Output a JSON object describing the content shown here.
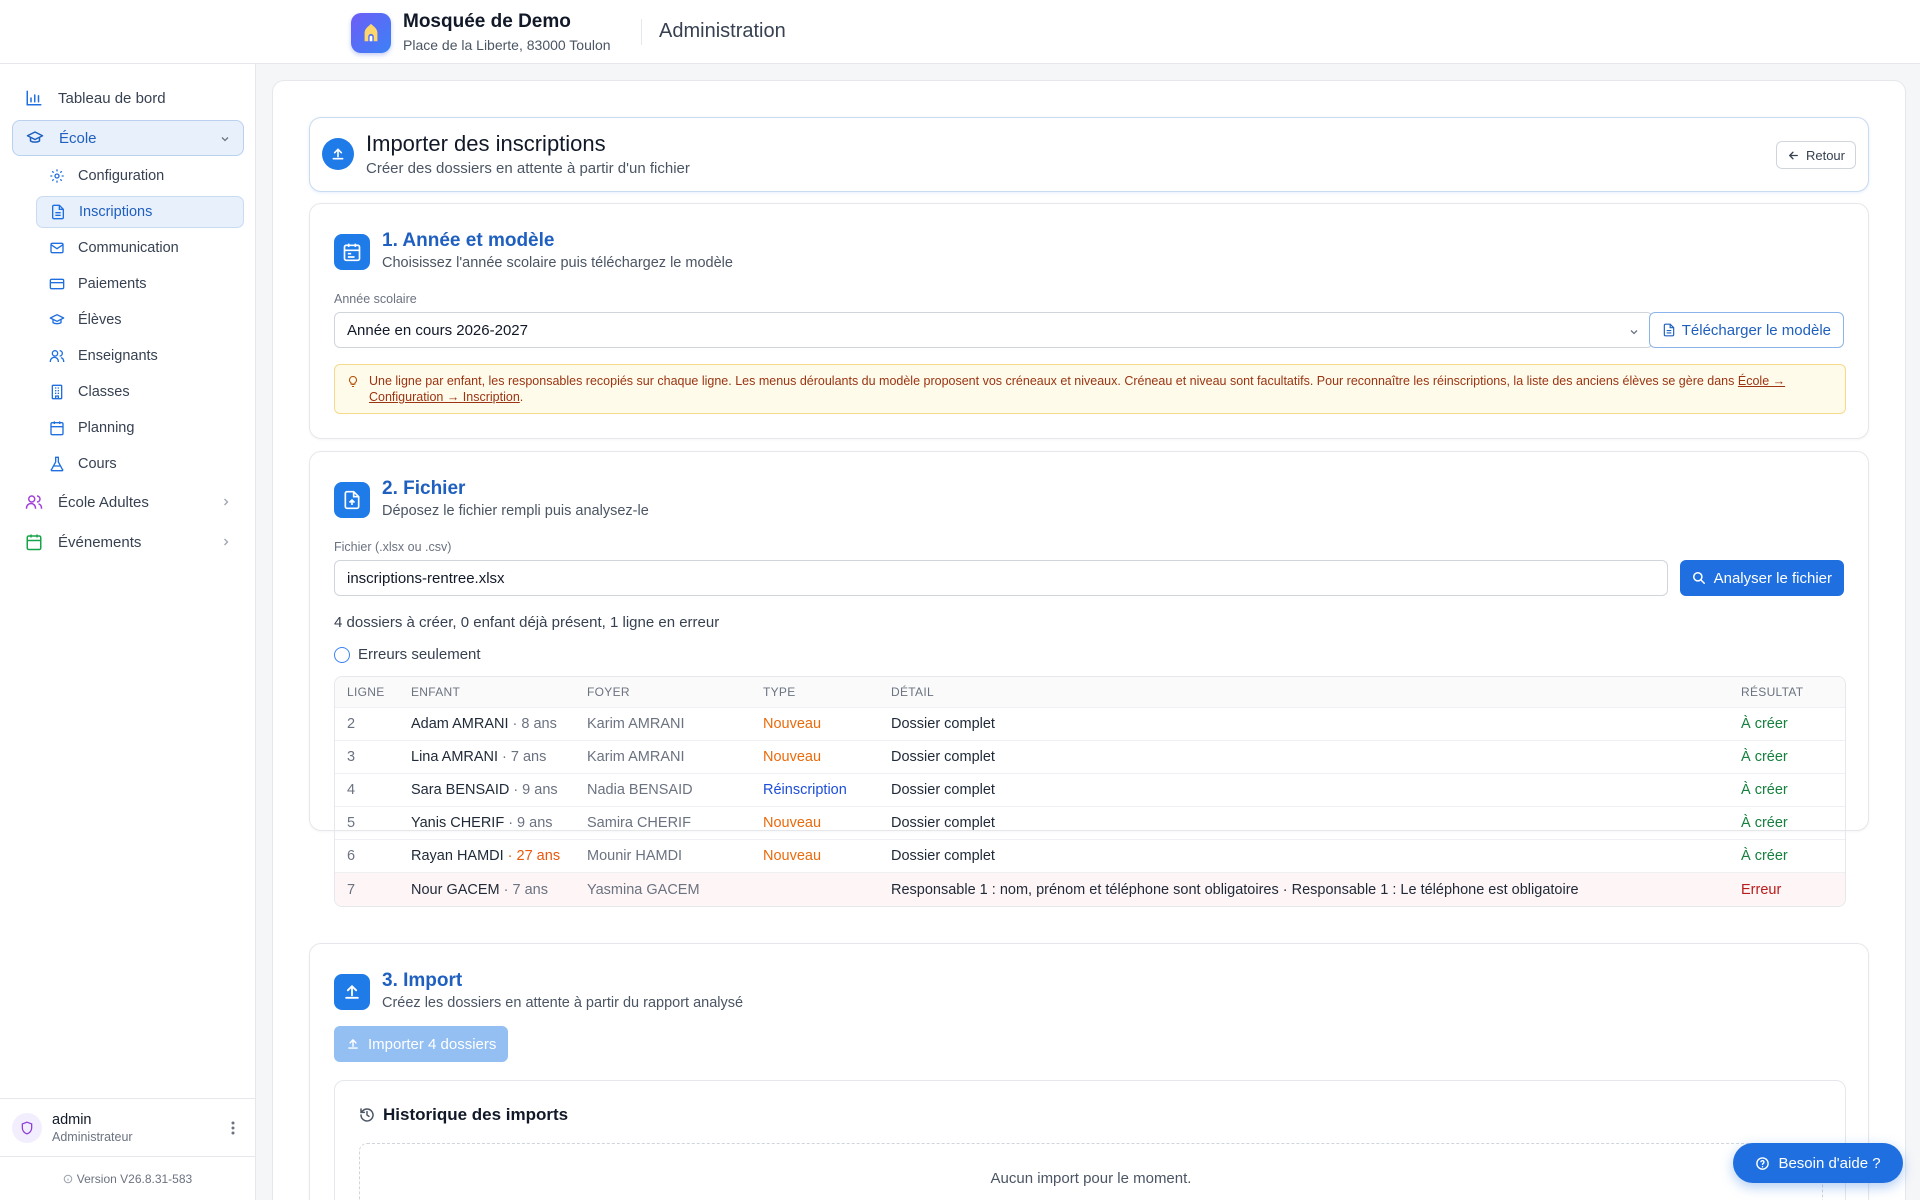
{
  "header": {
    "org_name": "Mosquée de Demo",
    "org_address": "Place de la Liberte, 83000 Toulon",
    "section_title": "Administration"
  },
  "sidebar": {
    "items": [
      {
        "label": "Tableau de bord",
        "icon": "bar-chart-icon"
      },
      {
        "label": "École",
        "icon": "graduation-cap-icon"
      },
      {
        "label": "École Adultes",
        "icon": "users-icon"
      },
      {
        "label": "Événements",
        "icon": "calendar-icon"
      }
    ],
    "school_subitems": [
      {
        "label": "Configuration",
        "icon": "gear-icon"
      },
      {
        "label": "Inscriptions",
        "icon": "file-text-icon"
      },
      {
        "label": "Communication",
        "icon": "mail-icon"
      },
      {
        "label": "Paiements",
        "icon": "credit-card-icon"
      },
      {
        "label": "Élèves",
        "icon": "graduation-cap-icon"
      },
      {
        "label": "Enseignants",
        "icon": "users-icon"
      },
      {
        "label": "Classes",
        "icon": "building-icon"
      },
      {
        "label": "Planning",
        "icon": "calendar-icon"
      },
      {
        "label": "Cours",
        "icon": "flask-icon"
      }
    ],
    "user": {
      "name": "admin",
      "role": "Administrateur"
    },
    "version": "Version V26.8.31-583"
  },
  "page": {
    "title": "Importer des inscriptions",
    "subtitle": "Créer des dossiers en attente à partir d'un fichier",
    "back_label": "Retour"
  },
  "step1": {
    "title": "1. Année et modèle",
    "subtitle": "Choisissez l'année scolaire puis téléchargez le modèle",
    "year_label": "Année scolaire",
    "year_value": "Année en cours 2026-2027",
    "download_label": "Télécharger le modèle",
    "tip_text": "Une ligne par enfant, les responsables recopiés sur chaque ligne. Les menus déroulants du modèle proposent vos créneaux et niveaux. Créneau et niveau sont facultatifs. Pour reconnaître les réinscriptions, la liste des anciens élèves se gère dans ",
    "tip_link": "École → Configuration → Inscription",
    "tip_end": "."
  },
  "step2": {
    "title": "2. Fichier",
    "subtitle": "Déposez le fichier rempli puis analysez-le",
    "file_label": "Fichier (.xlsx ou .csv)",
    "file_value": "inscriptions-rentree.xlsx",
    "analyze_label": "Analyser le fichier",
    "summary": "4 dossiers à créer, 0 enfant déjà présent, 1 ligne en erreur",
    "errors_only_label": "Erreurs seulement",
    "columns": [
      "LIGNE",
      "ENFANT",
      "FOYER",
      "TYPE",
      "DÉTAIL",
      "RÉSULTAT"
    ],
    "rows": [
      {
        "line": "2",
        "child": "Adam AMRANI",
        "age": "· 8 ans",
        "age_warn": false,
        "household": "Karim AMRANI",
        "type": "Nouveau",
        "type_kind": "new",
        "detail": "Dossier complet",
        "result": "À créer",
        "result_kind": "ok"
      },
      {
        "line": "3",
        "child": "Lina AMRANI",
        "age": "· 7 ans",
        "age_warn": false,
        "household": "Karim AMRANI",
        "type": "Nouveau",
        "type_kind": "new",
        "detail": "Dossier complet",
        "result": "À créer",
        "result_kind": "ok"
      },
      {
        "line": "4",
        "child": "Sara BENSAID",
        "age": "· 9 ans",
        "age_warn": false,
        "household": "Nadia BENSAID",
        "type": "Réinscription",
        "type_kind": "re",
        "detail": "Dossier complet",
        "result": "À créer",
        "result_kind": "ok"
      },
      {
        "line": "5",
        "child": "Yanis CHERIF",
        "age": "· 9 ans",
        "age_warn": false,
        "household": "Samira CHERIF",
        "type": "Nouveau",
        "type_kind": "new",
        "detail": "Dossier complet",
        "result": "À créer",
        "result_kind": "ok"
      },
      {
        "line": "6",
        "child": "Rayan HAMDI",
        "age": "· 27 ans",
        "age_warn": true,
        "household": "Mounir HAMDI",
        "type": "Nouveau",
        "type_kind": "new",
        "detail": "Dossier complet",
        "result": "À créer",
        "result_kind": "ok"
      },
      {
        "line": "7",
        "child": "Nour GACEM",
        "age": "· 7 ans",
        "age_warn": false,
        "household": "Yasmina GACEM",
        "type": "",
        "type_kind": "none",
        "detail": "Responsable 1 : nom, prénom et téléphone sont obligatoires · Responsable 1 : Le téléphone est obligatoire",
        "result": "Erreur",
        "result_kind": "error"
      }
    ]
  },
  "step3": {
    "title": "3. Import",
    "subtitle": "Créez les dossiers en attente à partir du rapport analysé",
    "import_label": "Importer 4 dossiers",
    "history_title": "Historique des imports",
    "history_empty": "Aucun import pour le moment."
  },
  "help_label": "Besoin d'aide ?",
  "colors": {
    "primary": "#1f6fe0",
    "accent_title": "#1f5fbf",
    "new": "#ea6a0c",
    "reinscription": "#1d4ed8",
    "ok": "#15803d",
    "error": "#b91c1c"
  }
}
